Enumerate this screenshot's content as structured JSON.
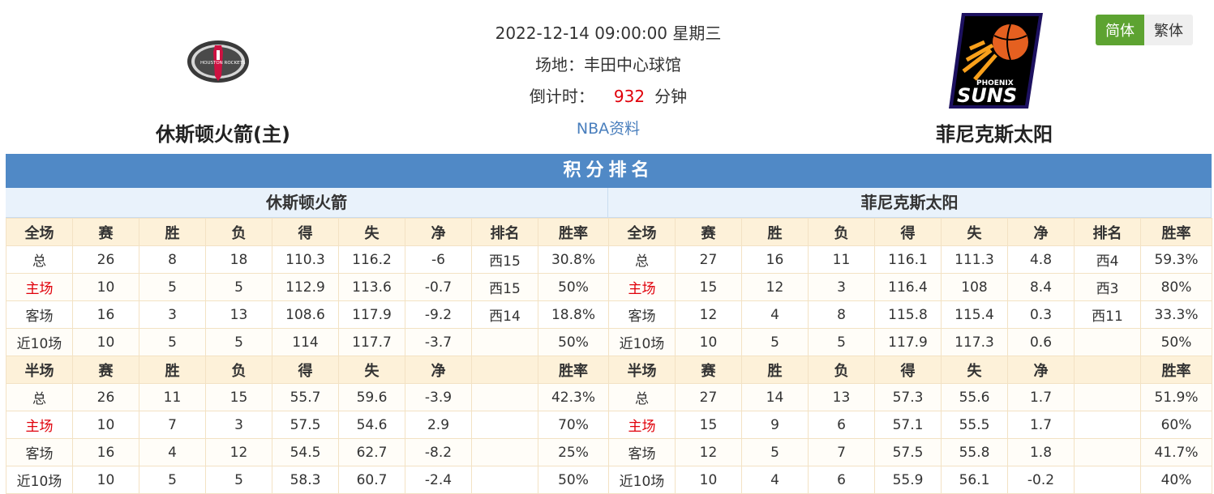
{
  "match": {
    "datetime": "2022-12-14 09:00:00 星期三",
    "venue": "场地：丰田中心球馆",
    "countdown_label": "倒计时：",
    "countdown_value": "932",
    "countdown_unit": "分钟",
    "link": "NBA资料"
  },
  "home_team": {
    "name": "休斯顿火箭(主)",
    "logo": "houston-rockets-logo",
    "logo_text": "HOUSTON ROCKETS"
  },
  "away_team": {
    "name": "菲尼克斯太阳",
    "logo": "phoenix-suns-logo",
    "logo_text_top": "PHOENIX",
    "logo_text_main": "SUNS"
  },
  "language": {
    "simplified": "简体",
    "traditional": "繁体"
  },
  "standings": {
    "title": "积分排名",
    "home": {
      "team": "休斯顿火箭",
      "full_header": [
        "全场",
        "赛",
        "胜",
        "负",
        "得",
        "失",
        "净",
        "排名",
        "胜率"
      ],
      "full_rows": [
        [
          "总",
          "26",
          "8",
          "18",
          "110.3",
          "116.2",
          "-6",
          "西15",
          "30.8%"
        ],
        [
          "主场",
          "10",
          "5",
          "5",
          "112.9",
          "113.6",
          "-0.7",
          "西15",
          "50%"
        ],
        [
          "客场",
          "16",
          "3",
          "13",
          "108.6",
          "117.9",
          "-9.2",
          "西14",
          "18.8%"
        ],
        [
          "近10场",
          "10",
          "5",
          "5",
          "114",
          "117.7",
          "-3.7",
          "",
          "50%"
        ]
      ],
      "half_header": [
        "半场",
        "赛",
        "胜",
        "负",
        "得",
        "失",
        "净",
        "",
        "胜率"
      ],
      "half_rows": [
        [
          "总",
          "26",
          "11",
          "15",
          "55.7",
          "59.6",
          "-3.9",
          "",
          "42.3%"
        ],
        [
          "主场",
          "10",
          "7",
          "3",
          "57.5",
          "54.6",
          "2.9",
          "",
          "70%"
        ],
        [
          "客场",
          "16",
          "4",
          "12",
          "54.5",
          "62.7",
          "-8.2",
          "",
          "25%"
        ],
        [
          "近10场",
          "10",
          "5",
          "5",
          "58.3",
          "60.7",
          "-2.4",
          "",
          "50%"
        ]
      ]
    },
    "away": {
      "team": "菲尼克斯太阳",
      "full_header": [
        "全场",
        "赛",
        "胜",
        "负",
        "得",
        "失",
        "净",
        "排名",
        "胜率"
      ],
      "full_rows": [
        [
          "总",
          "27",
          "16",
          "11",
          "116.1",
          "111.3",
          "4.8",
          "西4",
          "59.3%"
        ],
        [
          "主场",
          "15",
          "12",
          "3",
          "116.4",
          "108",
          "8.4",
          "西3",
          "80%"
        ],
        [
          "客场",
          "12",
          "4",
          "8",
          "115.8",
          "115.4",
          "0.3",
          "西11",
          "33.3%"
        ],
        [
          "近10场",
          "10",
          "5",
          "5",
          "117.9",
          "117.3",
          "0.6",
          "",
          "50%"
        ]
      ],
      "half_header": [
        "半场",
        "赛",
        "胜",
        "负",
        "得",
        "失",
        "净",
        "",
        "胜率"
      ],
      "half_rows": [
        [
          "总",
          "27",
          "14",
          "13",
          "57.3",
          "55.6",
          "1.7",
          "",
          "51.9%"
        ],
        [
          "主场",
          "15",
          "9",
          "6",
          "57.1",
          "55.5",
          "1.7",
          "",
          "60%"
        ],
        [
          "客场",
          "12",
          "5",
          "7",
          "57.5",
          "55.8",
          "1.8",
          "",
          "41.7%"
        ],
        [
          "近10场",
          "10",
          "4",
          "6",
          "55.9",
          "56.1",
          "-0.2",
          "",
          "40%"
        ]
      ]
    }
  },
  "colors": {
    "title_bar": "#5089c6",
    "accent_red": "#e0000a",
    "active_lang": "#5da331"
  }
}
